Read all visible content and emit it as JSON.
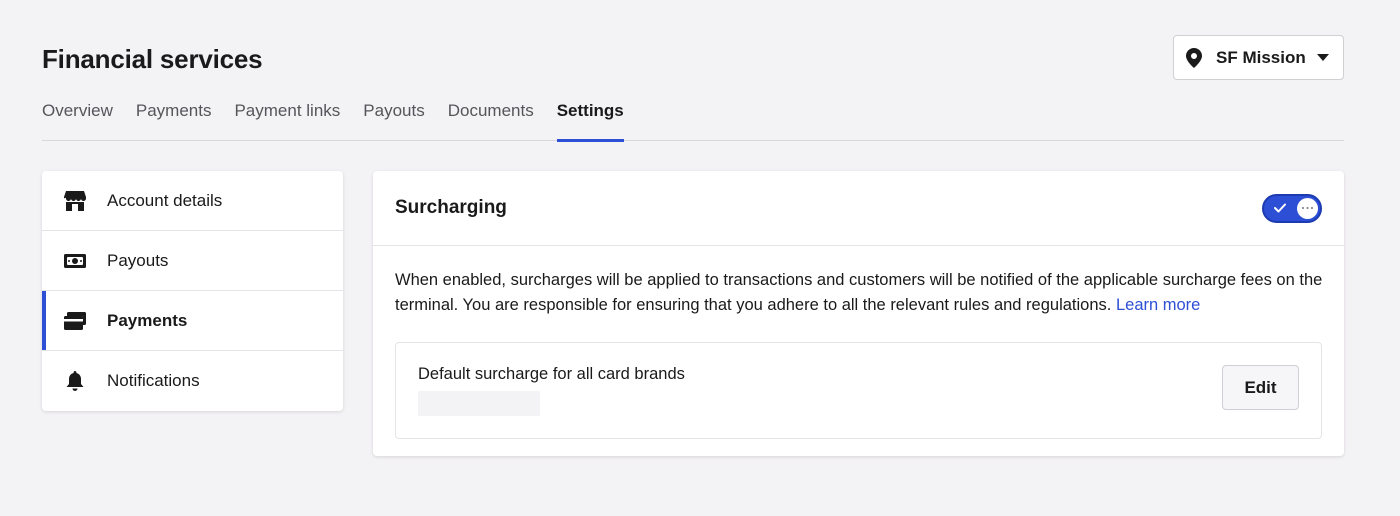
{
  "header": {
    "title": "Financial services",
    "location": {
      "label": "SF Mission",
      "icon": "map-pin-icon"
    }
  },
  "tabs": [
    {
      "label": "Overview",
      "active": false
    },
    {
      "label": "Payments",
      "active": false
    },
    {
      "label": "Payment links",
      "active": false
    },
    {
      "label": "Payouts",
      "active": false
    },
    {
      "label": "Documents",
      "active": false
    },
    {
      "label": "Settings",
      "active": true
    }
  ],
  "sidenav": {
    "items": [
      {
        "label": "Account details",
        "icon": "storefront-icon",
        "active": false
      },
      {
        "label": "Payouts",
        "icon": "cash-icon",
        "active": false
      },
      {
        "label": "Payments",
        "icon": "card-icon",
        "active": true
      },
      {
        "label": "Notifications",
        "icon": "bell-icon",
        "active": false
      }
    ]
  },
  "surcharging": {
    "title": "Surcharging",
    "toggle_on": true,
    "description": "When enabled, surcharges will be applied to transactions and customers will be notified of the applicable surcharge fees on the terminal. You are responsible for ensuring that you adhere to all the relevant rules and regulations.",
    "learn_more": "Learn more",
    "default_label": "Default surcharge for all card brands",
    "edit_label": "Edit"
  },
  "colors": {
    "accent": "#2d4fd6",
    "background": "#f3f2f5",
    "surface": "#ffffff"
  }
}
